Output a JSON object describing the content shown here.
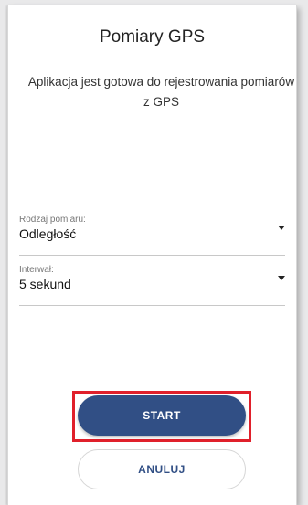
{
  "header": {
    "title": "Pomiary GPS",
    "message": "Aplikacja jest gotowa do rejestrowania pomiarów z GPS"
  },
  "form": {
    "measurement_type": {
      "label": "Rodzaj pomiaru:",
      "value": "Odległość"
    },
    "interval": {
      "label": "Interwał:",
      "value": "5 sekund"
    }
  },
  "actions": {
    "start_label": "START",
    "cancel_label": "ANULUJ"
  },
  "colors": {
    "primary": "#314f85",
    "highlight": "#e0202b"
  }
}
